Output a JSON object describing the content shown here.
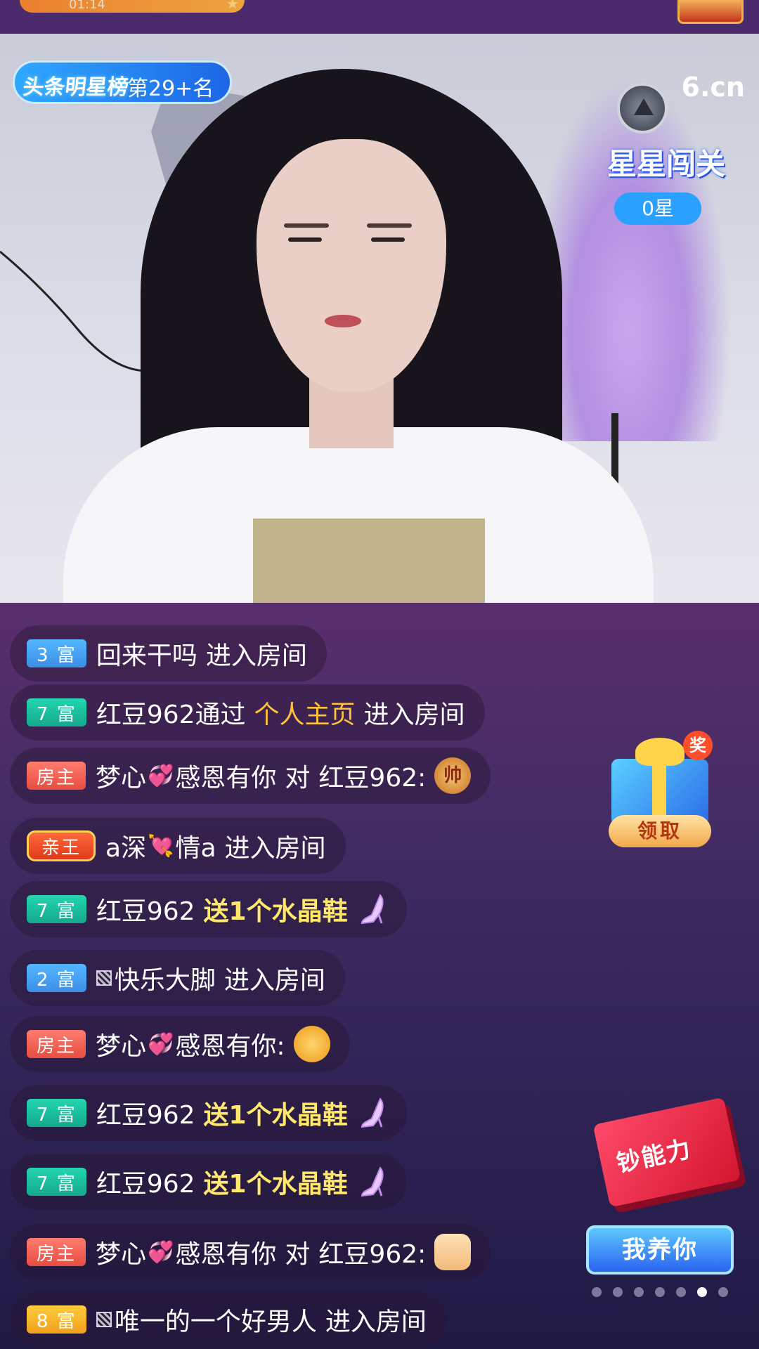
{
  "top": {
    "time": "01:14"
  },
  "video": {
    "rank_badge": {
      "logo": "头条明星榜",
      "rank": "第29+名"
    },
    "site_logo": "6.cn",
    "game": {
      "title": "星星闯关",
      "stars": "0星"
    }
  },
  "chat": [
    {
      "badge": "3 富",
      "badge_color": "#3c8fe6",
      "user": "回来干吗",
      "action": "进入房间"
    },
    {
      "badge": "7 富",
      "badge_color": "#14a88c",
      "user": "红豆962通过",
      "link": "个人主页",
      "action": "进入房间"
    },
    {
      "badge": "房主",
      "badge_color": "#e84d40",
      "user_a": "梦心",
      "user_b": "感恩有你",
      "to": "对",
      "target": "红豆962:",
      "emoji": "帅"
    },
    {
      "badge": "亲王",
      "badge_color": "#e03a1b",
      "user_a": "a深",
      "user_b": "情a",
      "action": "进入房间"
    },
    {
      "badge": "7 富",
      "badge_color": "#14a88c",
      "user": "红豆962",
      "gift": "送1个水晶鞋"
    },
    {
      "badge": "2 富",
      "badge_color": "#3c8fe6",
      "user": "快乐大脚",
      "action": "进入房间"
    },
    {
      "badge": "房主",
      "badge_color": "#e84d40",
      "user_a": "梦心",
      "user_b": "感恩有你:"
    },
    {
      "badge": "7 富",
      "badge_color": "#14a88c",
      "user": "红豆962",
      "gift": "送1个水晶鞋"
    },
    {
      "badge": "7 富",
      "badge_color": "#14a88c",
      "user": "红豆962",
      "gift": "送1个水晶鞋"
    },
    {
      "badge": "房主",
      "badge_color": "#e84d40",
      "user_a": "梦心",
      "user_b": "感恩有你",
      "to": "对",
      "target": "红豆962:"
    },
    {
      "badge": "8 富",
      "badge_color": "#f0a01a",
      "user": "唯一的一个好男人",
      "action": "进入房间"
    }
  ],
  "widgets": {
    "gift": {
      "tag": "奖",
      "claim": "领取"
    },
    "power": {
      "label": "钞能力",
      "button": "我养你"
    },
    "pager": {
      "total": 7,
      "active_index": 5
    }
  }
}
